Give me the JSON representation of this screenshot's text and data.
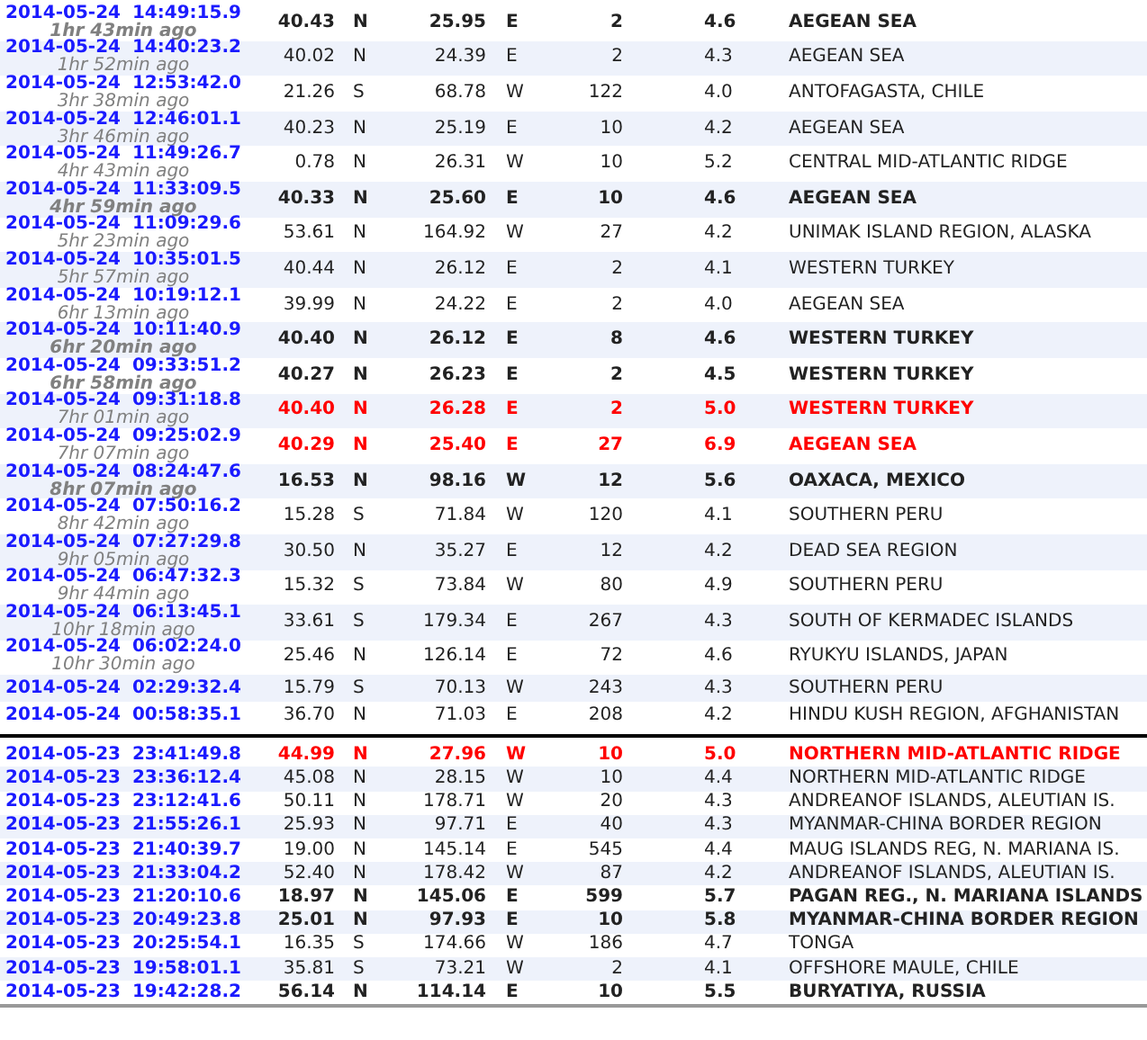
{
  "groups": [
    {
      "rows": [
        {
          "datetime": "2014-05-24 14:49:15.9",
          "ago": "1hr 43min ago",
          "lat": "40.43",
          "ns": "N",
          "lon": "25.95",
          "ew": "E",
          "depth": "2",
          "mag": "4.6",
          "region": "AEGEAN SEA",
          "kind": "bold"
        },
        {
          "datetime": "2014-05-24 14:40:23.2",
          "ago": "1hr 52min ago",
          "lat": "40.02",
          "ns": "N",
          "lon": "24.39",
          "ew": "E",
          "depth": "2",
          "mag": "4.3",
          "region": "AEGEAN SEA",
          "kind": "normal"
        },
        {
          "datetime": "2014-05-24 12:53:42.0",
          "ago": "3hr 38min ago",
          "lat": "21.26",
          "ns": "S",
          "lon": "68.78",
          "ew": "W",
          "depth": "122",
          "mag": "4.0",
          "region": "ANTOFAGASTA, CHILE",
          "kind": "normal"
        },
        {
          "datetime": "2014-05-24 12:46:01.1",
          "ago": "3hr 46min ago",
          "lat": "40.23",
          "ns": "N",
          "lon": "25.19",
          "ew": "E",
          "depth": "10",
          "mag": "4.2",
          "region": "AEGEAN SEA",
          "kind": "normal"
        },
        {
          "datetime": "2014-05-24 11:49:26.7",
          "ago": "4hr 43min ago",
          "lat": "0.78",
          "ns": "N",
          "lon": "26.31",
          "ew": "W",
          "depth": "10",
          "mag": "5.2",
          "region": "CENTRAL MID-ATLANTIC RIDGE",
          "kind": "normal"
        },
        {
          "datetime": "2014-05-24 11:33:09.5",
          "ago": "4hr 59min ago",
          "lat": "40.33",
          "ns": "N",
          "lon": "25.60",
          "ew": "E",
          "depth": "10",
          "mag": "4.6",
          "region": "AEGEAN SEA",
          "kind": "bold"
        },
        {
          "datetime": "2014-05-24 11:09:29.6",
          "ago": "5hr 23min ago",
          "lat": "53.61",
          "ns": "N",
          "lon": "164.92",
          "ew": "W",
          "depth": "27",
          "mag": "4.2",
          "region": "UNIMAK ISLAND REGION, ALASKA",
          "kind": "normal"
        },
        {
          "datetime": "2014-05-24 10:35:01.5",
          "ago": "5hr 57min ago",
          "lat": "40.44",
          "ns": "N",
          "lon": "26.12",
          "ew": "E",
          "depth": "2",
          "mag": "4.1",
          "region": "WESTERN TURKEY",
          "kind": "normal"
        },
        {
          "datetime": "2014-05-24 10:19:12.1",
          "ago": "6hr 13min ago",
          "lat": "39.99",
          "ns": "N",
          "lon": "24.22",
          "ew": "E",
          "depth": "2",
          "mag": "4.0",
          "region": "AEGEAN SEA",
          "kind": "normal"
        },
        {
          "datetime": "2014-05-24 10:11:40.9",
          "ago": "6hr 20min ago",
          "lat": "40.40",
          "ns": "N",
          "lon": "26.12",
          "ew": "E",
          "depth": "8",
          "mag": "4.6",
          "region": "WESTERN TURKEY",
          "kind": "bold"
        },
        {
          "datetime": "2014-05-24 09:33:51.2",
          "ago": "6hr 58min ago",
          "lat": "40.27",
          "ns": "N",
          "lon": "26.23",
          "ew": "E",
          "depth": "2",
          "mag": "4.5",
          "region": "WESTERN TURKEY",
          "kind": "bold"
        },
        {
          "datetime": "2014-05-24 09:31:18.8",
          "ago": "7hr 01min ago",
          "lat": "40.40",
          "ns": "N",
          "lon": "26.28",
          "ew": "E",
          "depth": "2",
          "mag": "5.0",
          "region": "WESTERN TURKEY",
          "kind": "red"
        },
        {
          "datetime": "2014-05-24 09:25:02.9",
          "ago": "7hr 07min ago",
          "lat": "40.29",
          "ns": "N",
          "lon": "25.40",
          "ew": "E",
          "depth": "27",
          "mag": "6.9",
          "region": "AEGEAN SEA",
          "kind": "red"
        },
        {
          "datetime": "2014-05-24 08:24:47.6",
          "ago": "8hr 07min ago",
          "lat": "16.53",
          "ns": "N",
          "lon": "98.16",
          "ew": "W",
          "depth": "12",
          "mag": "5.6",
          "region": "OAXACA, MEXICO",
          "kind": "bold"
        },
        {
          "datetime": "2014-05-24 07:50:16.2",
          "ago": "8hr 42min ago",
          "lat": "15.28",
          "ns": "S",
          "lon": "71.84",
          "ew": "W",
          "depth": "120",
          "mag": "4.1",
          "region": "SOUTHERN PERU",
          "kind": "normal"
        },
        {
          "datetime": "2014-05-24 07:27:29.8",
          "ago": "9hr 05min ago",
          "lat": "30.50",
          "ns": "N",
          "lon": "35.27",
          "ew": "E",
          "depth": "12",
          "mag": "4.2",
          "region": "DEAD SEA REGION",
          "kind": "normal"
        },
        {
          "datetime": "2014-05-24 06:47:32.3",
          "ago": "9hr 44min ago",
          "lat": "15.32",
          "ns": "S",
          "lon": "73.84",
          "ew": "W",
          "depth": "80",
          "mag": "4.9",
          "region": "SOUTHERN PERU",
          "kind": "normal"
        },
        {
          "datetime": "2014-05-24 06:13:45.1",
          "ago": "10hr 18min ago",
          "lat": "33.61",
          "ns": "S",
          "lon": "179.34",
          "ew": "E",
          "depth": "267",
          "mag": "4.3",
          "region": "SOUTH OF KERMADEC ISLANDS",
          "kind": "normal"
        },
        {
          "datetime": "2014-05-24 06:02:24.0",
          "ago": "10hr 30min ago",
          "lat": "25.46",
          "ns": "N",
          "lon": "126.14",
          "ew": "E",
          "depth": "72",
          "mag": "4.6",
          "region": "RYUKYU ISLANDS, JAPAN",
          "kind": "normal"
        },
        {
          "datetime": "2014-05-24 02:29:32.4",
          "lat": "15.79",
          "ns": "S",
          "lon": "70.13",
          "ew": "W",
          "depth": "243",
          "mag": "4.3",
          "region": "SOUTHERN PERU",
          "kind": "normal"
        },
        {
          "datetime": "2014-05-24 00:58:35.1",
          "lat": "36.70",
          "ns": "N",
          "lon": "71.03",
          "ew": "E",
          "depth": "208",
          "mag": "4.2",
          "region": "HINDU KUSH REGION, AFGHANISTAN",
          "kind": "normal"
        }
      ]
    },
    {
      "rows": [
        {
          "datetime": "2014-05-23 23:41:49.8",
          "lat": "44.99",
          "ns": "N",
          "lon": "27.96",
          "ew": "W",
          "depth": "10",
          "mag": "5.0",
          "region": "NORTHERN MID-ATLANTIC RIDGE",
          "kind": "red"
        },
        {
          "datetime": "2014-05-23 23:36:12.4",
          "lat": "45.08",
          "ns": "N",
          "lon": "28.15",
          "ew": "W",
          "depth": "10",
          "mag": "4.4",
          "region": "NORTHERN MID-ATLANTIC RIDGE",
          "kind": "normal"
        },
        {
          "datetime": "2014-05-23 23:12:41.6",
          "lat": "50.11",
          "ns": "N",
          "lon": "178.71",
          "ew": "W",
          "depth": "20",
          "mag": "4.3",
          "region": "ANDREANOF ISLANDS, ALEUTIAN IS.",
          "kind": "normal"
        },
        {
          "datetime": "2014-05-23 21:55:26.1",
          "lat": "25.93",
          "ns": "N",
          "lon": "97.71",
          "ew": "E",
          "depth": "40",
          "mag": "4.3",
          "region": "MYANMAR-CHINA BORDER REGION",
          "kind": "normal"
        },
        {
          "datetime": "2014-05-23 21:40:39.7",
          "lat": "19.00",
          "ns": "N",
          "lon": "145.14",
          "ew": "E",
          "depth": "545",
          "mag": "4.4",
          "region": "MAUG ISLANDS REG, N. MARIANA IS.",
          "kind": "normal"
        },
        {
          "datetime": "2014-05-23 21:33:04.2",
          "lat": "52.40",
          "ns": "N",
          "lon": "178.42",
          "ew": "W",
          "depth": "87",
          "mag": "4.2",
          "region": "ANDREANOF ISLANDS, ALEUTIAN IS.",
          "kind": "normal"
        },
        {
          "datetime": "2014-05-23 21:20:10.6",
          "lat": "18.97",
          "ns": "N",
          "lon": "145.06",
          "ew": "E",
          "depth": "599",
          "mag": "5.7",
          "region": "PAGAN REG., N. MARIANA ISLANDS",
          "kind": "bold"
        },
        {
          "datetime": "2014-05-23 20:49:23.8",
          "lat": "25.01",
          "ns": "N",
          "lon": "97.93",
          "ew": "E",
          "depth": "10",
          "mag": "5.8",
          "region": "MYANMAR-CHINA BORDER REGION",
          "kind": "bold"
        },
        {
          "datetime": "2014-05-23 20:25:54.1",
          "lat": "16.35",
          "ns": "S",
          "lon": "174.66",
          "ew": "W",
          "depth": "186",
          "mag": "4.7",
          "region": "TONGA",
          "kind": "normal"
        },
        {
          "datetime": "2014-05-23 19:58:01.1",
          "lat": "35.81",
          "ns": "S",
          "lon": "73.21",
          "ew": "W",
          "depth": "2",
          "mag": "4.1",
          "region": "OFFSHORE MAULE, CHILE",
          "kind": "normal"
        },
        {
          "datetime": "2014-05-23 19:42:28.2",
          "lat": "56.14",
          "ns": "N",
          "lon": "114.14",
          "ew": "E",
          "depth": "10",
          "mag": "5.5",
          "region": "BURYATIYA, RUSSIA",
          "kind": "bold"
        }
      ]
    }
  ]
}
